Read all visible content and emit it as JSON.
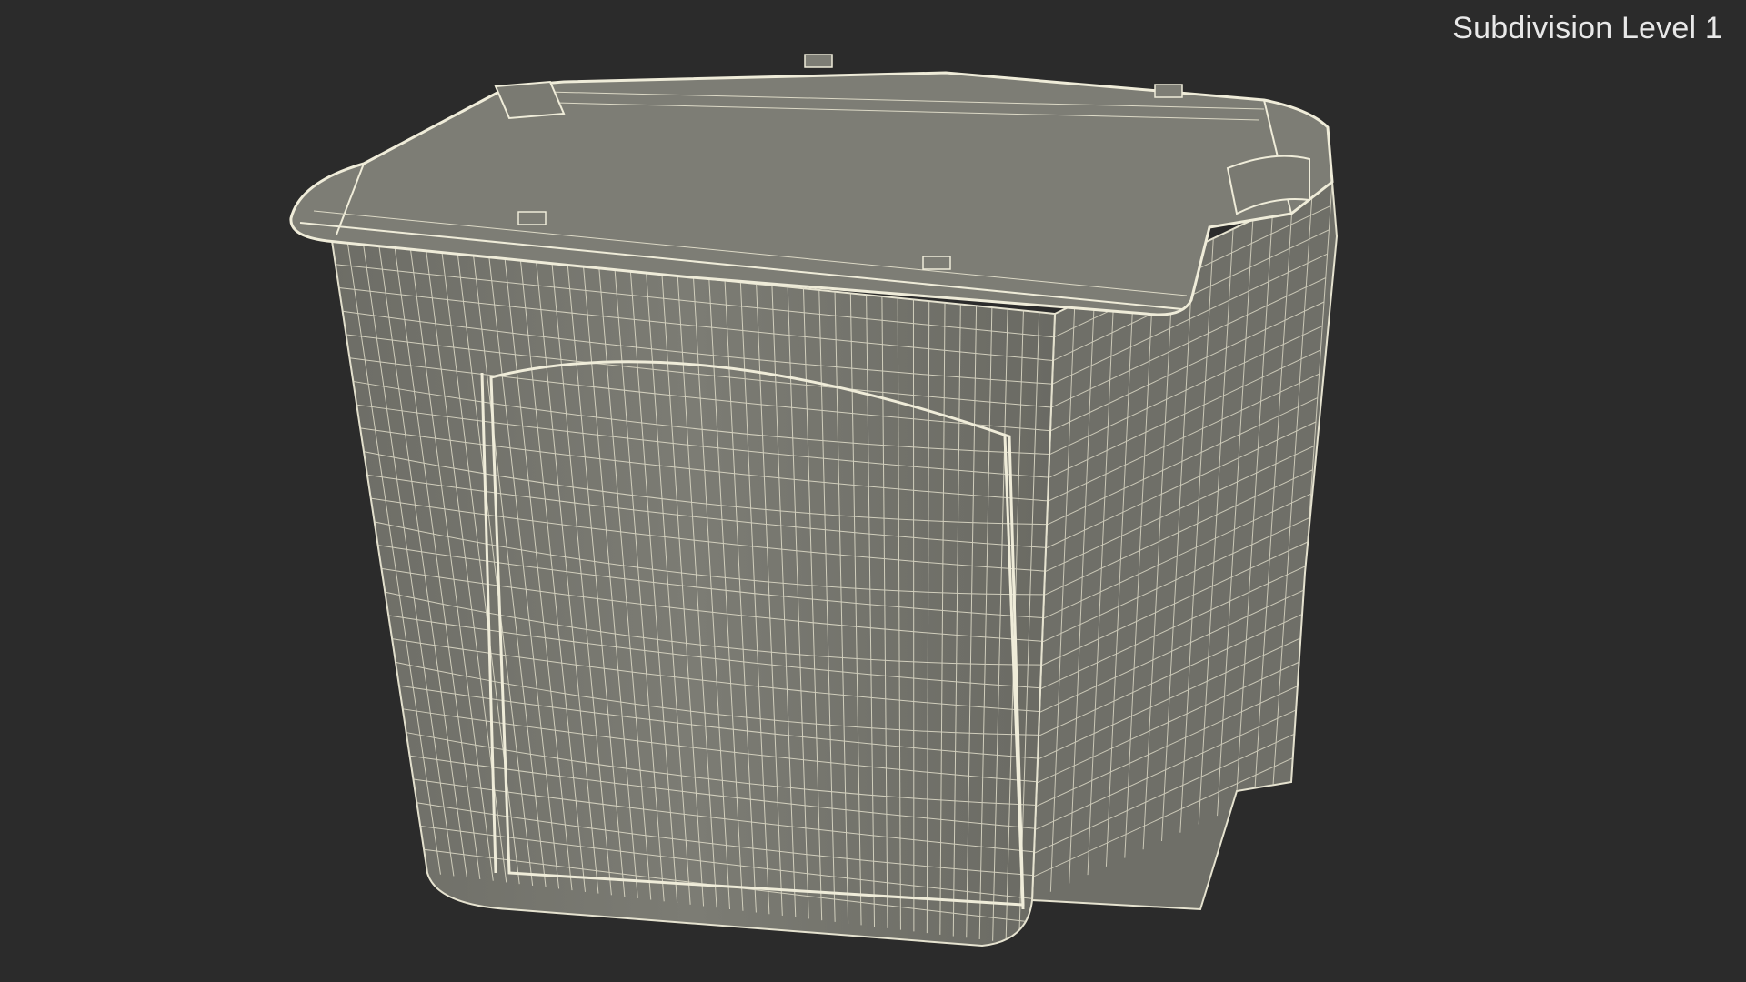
{
  "render": {
    "caption": "Subdivision Level 1",
    "background_color": "#2b2b2b",
    "mesh_fill_color": "#76766e",
    "wire_color": "#e6e3d0",
    "caption_color": "#e8e8e8"
  },
  "model": {
    "subject": "storage-tub",
    "display_mode": "wireframe-on-shaded"
  }
}
